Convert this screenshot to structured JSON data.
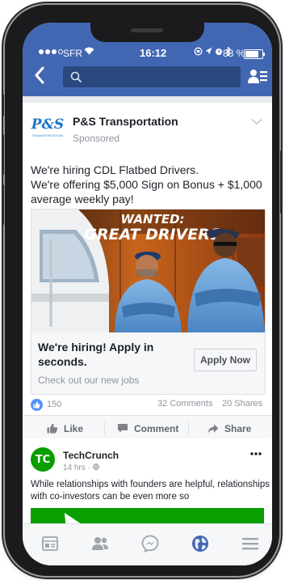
{
  "status_bar": {
    "carrier": "SFR",
    "time": "16:12",
    "battery_percent": "88 %",
    "battery_level": 0.88
  },
  "navbar": {
    "back_icon": "chevron-left-icon",
    "search_icon": "magnifier-icon",
    "friends_icon": "friends-list-icon",
    "accent_color": "#4267b2"
  },
  "ad_post": {
    "page_logo_text": "P&S",
    "page_logo_subtext": "TRANSPORTATION",
    "page_name": "P&S Transportation",
    "sponsored_label": "Sponsored",
    "text_lines": [
      "We're hiring CDL Flatbed Drivers.",
      "We're offering $5,000 Sign on Bonus + $1,000",
      "average weekly pay!"
    ],
    "image_banner_line1": "WANTED:",
    "image_banner_line2": "GREAT DRIVERS",
    "headline": "We're hiring! Apply in seconds.",
    "description": "Check out our new jobs",
    "cta_label": "Apply Now",
    "likes": "150",
    "comments": "32 Comments",
    "shares": "20 Shares"
  },
  "actions": {
    "like": "Like",
    "comment": "Comment",
    "share": "Share"
  },
  "tc_post": {
    "logo_text": "TC",
    "page_name": "TechCrunch",
    "time": "14 hrs",
    "menu_icon": "more-dots-icon",
    "text_lines": [
      "While relationships with founders are helpful, relationships",
      "with co-investors can be even more so"
    ]
  },
  "tabbar": {
    "tabs": [
      "news-feed-icon",
      "friends-icon",
      "messenger-icon",
      "globe-icon",
      "menu-icon"
    ],
    "active_tab": "globe-icon"
  }
}
